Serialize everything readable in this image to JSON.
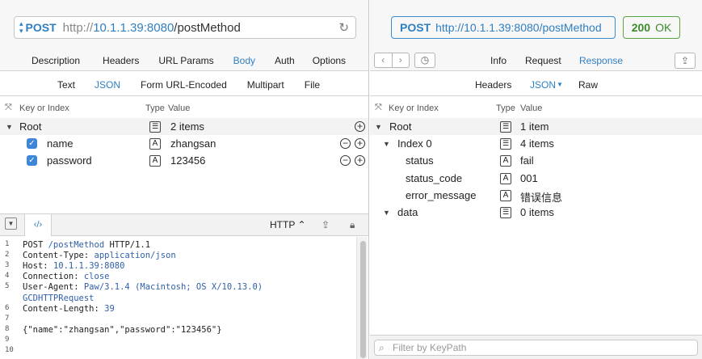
{
  "request": {
    "method": "POST",
    "url_scheme": "http://",
    "url_host": "10.1.1.39:8080",
    "url_path": "/postMethod",
    "tabs": [
      "Description",
      "Headers",
      "URL Params",
      "Body",
      "Auth",
      "Options"
    ],
    "active_tab": "Body",
    "body_tabs": [
      "Text",
      "JSON",
      "Form URL-Encoded",
      "Multipart",
      "File"
    ],
    "active_body_tab": "JSON",
    "columns": {
      "key": "Key or Index",
      "type": "Type",
      "value": "Value"
    },
    "root": {
      "key": "Root",
      "value": "2 items"
    },
    "fields": [
      {
        "key": "name",
        "type": "A",
        "value": "zhangsan"
      },
      {
        "key": "password",
        "type": "A",
        "value": "123456"
      }
    ]
  },
  "code_panel": {
    "format": "HTTP ⌃",
    "lines": [
      {
        "n": "1",
        "text": "POST ",
        "hl": "/postMethod",
        "rest": " HTTP/1.1"
      },
      {
        "n": "2",
        "text": "Content-Type: ",
        "hl": "application/json",
        "rest": ""
      },
      {
        "n": "3",
        "text": "Host: ",
        "hl": "10.1.1.39:8080",
        "rest": ""
      },
      {
        "n": "4",
        "text": "Connection: ",
        "hl": "close",
        "rest": ""
      },
      {
        "n": "5",
        "text": "User-Agent: ",
        "hl": "Paw/3.1.4 (Macintosh; OS X/10.13.0)",
        "rest": ""
      },
      {
        "n": "",
        "text": "",
        "hl": "GCDHTTPRequest",
        "rest": ""
      },
      {
        "n": "6",
        "text": "Content-Length: ",
        "hl": "39",
        "rest": ""
      },
      {
        "n": "7",
        "text": "",
        "hl": "",
        "rest": ""
      },
      {
        "n": "8",
        "text": "{\"name\":\"zhangsan\",\"password\":\"123456\"}",
        "hl": "",
        "rest": ""
      },
      {
        "n": "9",
        "text": "",
        "hl": "",
        "rest": ""
      },
      {
        "n": "10",
        "text": "",
        "hl": "",
        "rest": ""
      }
    ]
  },
  "response": {
    "method": "POST",
    "url": "http://10.1.1.39:8080/postMethod",
    "status_code": "200",
    "status_text": "OK",
    "tabs": [
      "Info",
      "Request",
      "Response"
    ],
    "active_tab": "Response",
    "sub_tabs": [
      "Headers",
      "JSON",
      "Raw"
    ],
    "active_sub_tab": "JSON",
    "columns": {
      "key": "Key or Index",
      "type": "Type",
      "value": "Value"
    },
    "tree": [
      {
        "key": "Root",
        "type": "list",
        "value": "1 item",
        "level": 0,
        "expand": true
      },
      {
        "key": "Index 0",
        "type": "list",
        "value": "4 items",
        "level": 1,
        "expand": true
      },
      {
        "key": "status",
        "type": "A",
        "value": "fail",
        "level": 2,
        "expand": false
      },
      {
        "key": "status_code",
        "type": "A",
        "value": "001",
        "level": 2,
        "expand": false
      },
      {
        "key": "error_message",
        "type": "A",
        "value": "错误信息",
        "level": 2,
        "expand": false
      },
      {
        "key": "data",
        "type": "list",
        "value": "0 items",
        "level": 1,
        "expand": true
      }
    ],
    "filter_placeholder": "Filter by KeyPath"
  }
}
